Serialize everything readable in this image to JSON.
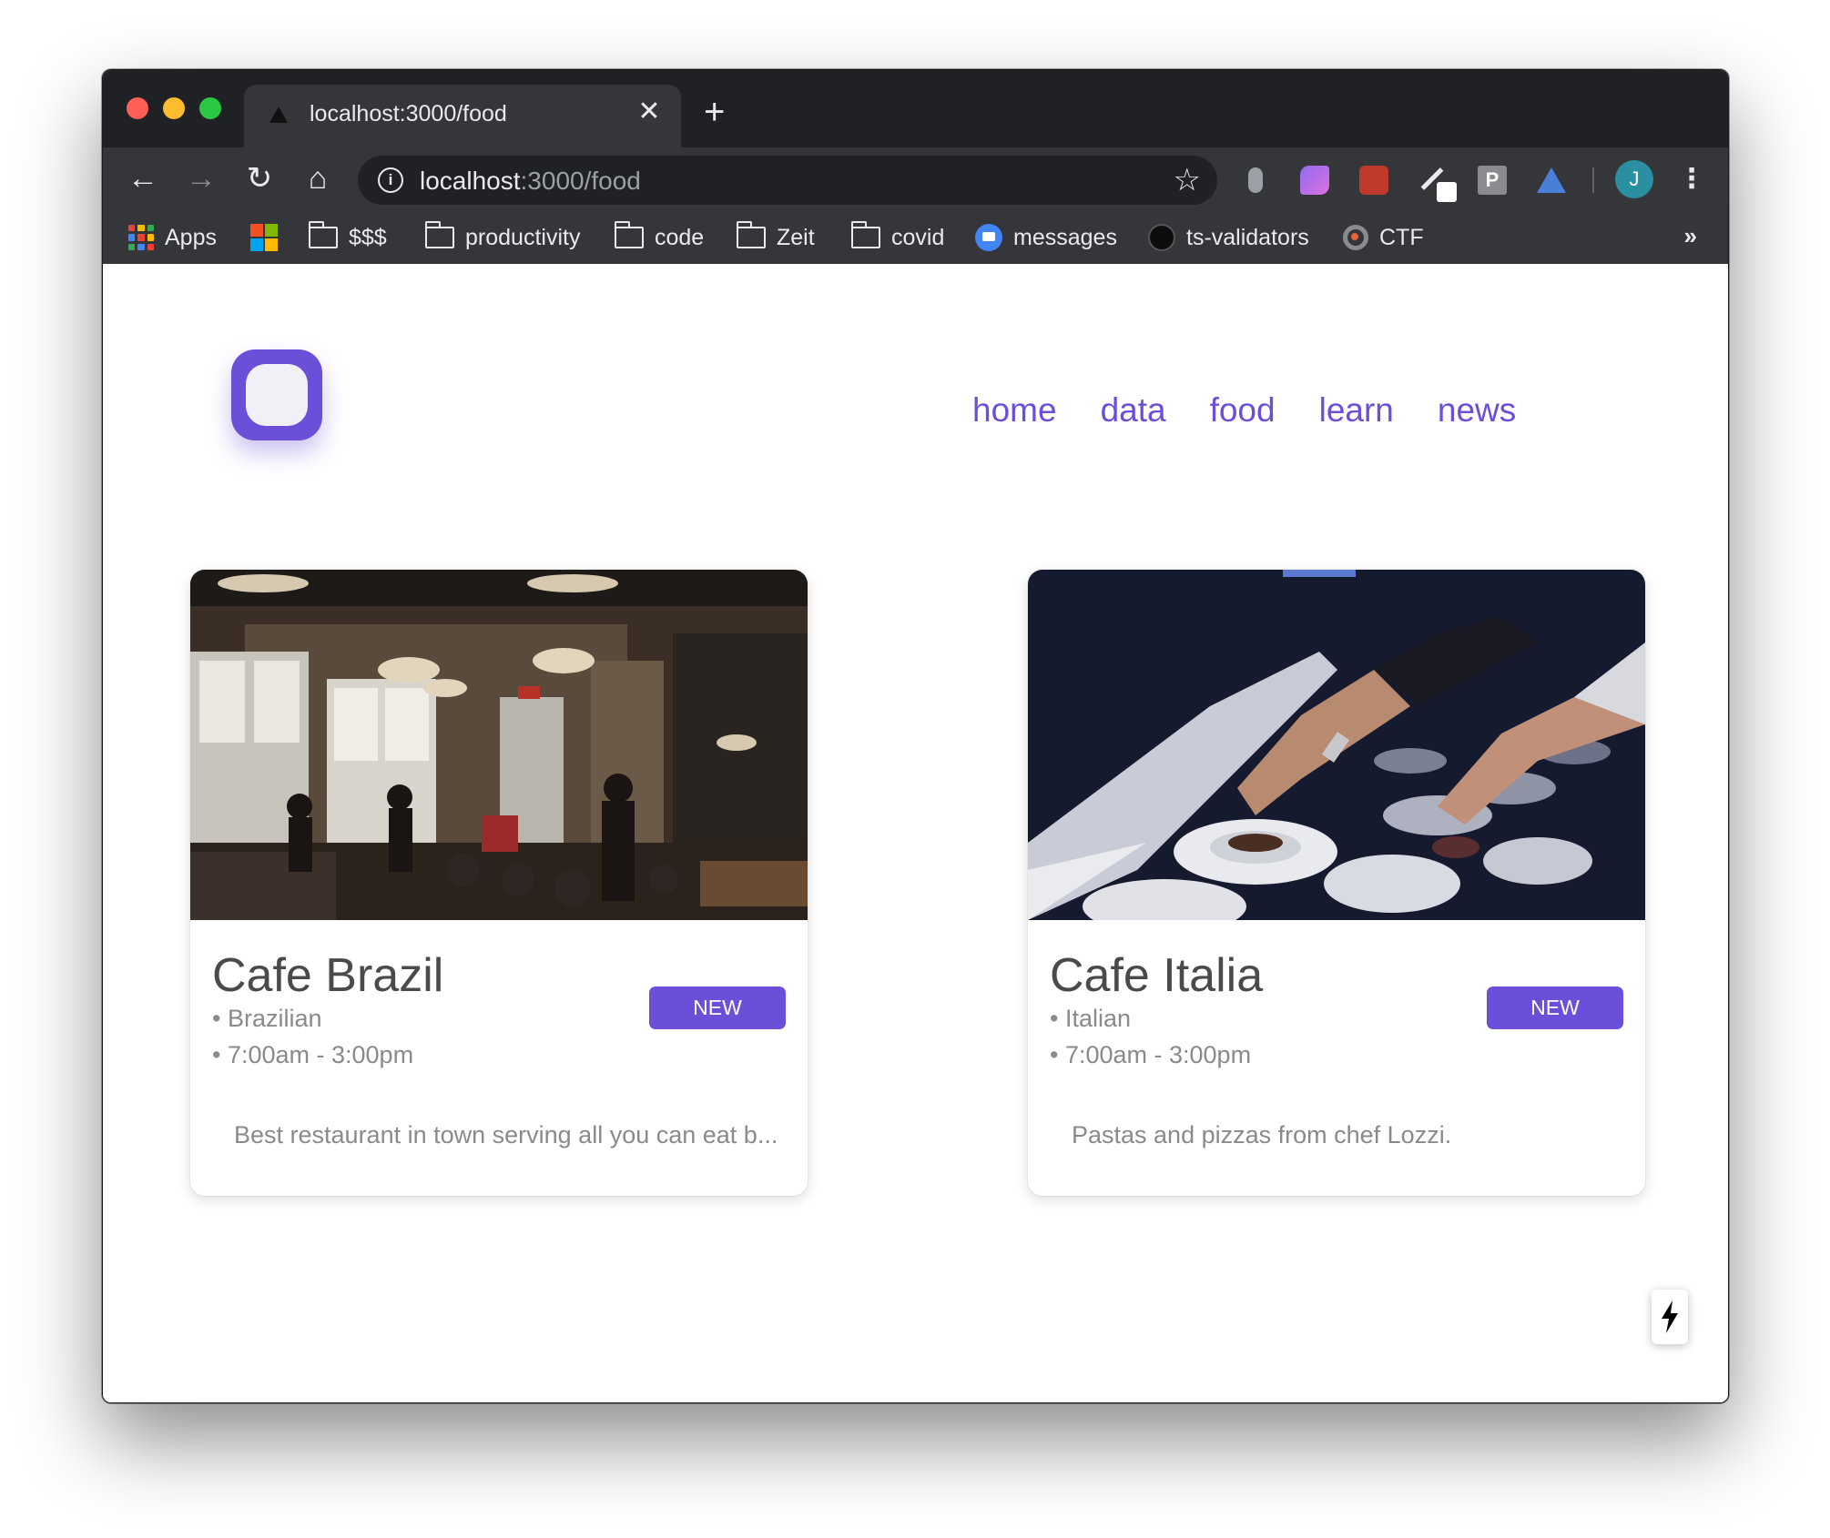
{
  "browser": {
    "tab": {
      "title": "localhost:3000/food",
      "close_glyph": "✕"
    },
    "new_tab_glyph": "+",
    "nav": {
      "back_glyph": "←",
      "forward_glyph": "→",
      "reload_glyph": "↻",
      "home_glyph": "⌂"
    },
    "address": {
      "host": "localhost",
      "rest": ":3000/food"
    },
    "star_glyph": "☆",
    "extensions": {
      "p_label": "P"
    },
    "profile_initial": "J",
    "menu_glyph": "⋮",
    "bookmarks": [
      {
        "label": "Apps",
        "icon": "apps-grid-icon"
      },
      {
        "label": "",
        "icon": "microsoft-icon"
      },
      {
        "label": "$$$",
        "icon": "folder-icon"
      },
      {
        "label": "productivity",
        "icon": "folder-icon"
      },
      {
        "label": "code",
        "icon": "folder-icon"
      },
      {
        "label": "Zeit",
        "icon": "folder-icon"
      },
      {
        "label": "covid",
        "icon": "folder-icon"
      },
      {
        "label": "messages",
        "icon": "messages-icon"
      },
      {
        "label": "ts-validators",
        "icon": "github-icon"
      },
      {
        "label": "CTF",
        "icon": "ctf-icon"
      }
    ],
    "bookmarks_more_glyph": "»"
  },
  "site": {
    "nav": [
      "home",
      "data",
      "food",
      "learn",
      "news"
    ],
    "accent": "#6c4fd8"
  },
  "cards": [
    {
      "title": "Cafe Brazil",
      "cuisine": "• Brazilian",
      "hours": "• 7:00am - 3:00pm",
      "badge": "NEW",
      "description": "Best restaurant in town serving all you can eat b..."
    },
    {
      "title": "Cafe Italia",
      "cuisine": "• Italian",
      "hours": "• 7:00am - 3:00pm",
      "badge": "NEW",
      "description": "Pastas and pizzas from chef Lozzi."
    }
  ]
}
